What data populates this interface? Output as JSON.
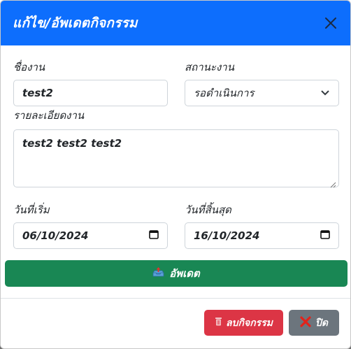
{
  "modal": {
    "title": "แก้ไข/อัพเดตกิจกรรม"
  },
  "form": {
    "name_label": "ชื่องาน",
    "name_value": "test2",
    "status_label": "สถานะงาน",
    "status_value": "รอดำเนินการ",
    "detail_label": "รายละเอียดงาน",
    "detail_value": "test2 test2 test2",
    "start_label": "วันที่เริ่ม",
    "start_value": "06/10/2024",
    "end_label": "วันที่สิ้นสุด",
    "end_value": "16/10/2024"
  },
  "actions": {
    "update_label": "อัพเดต",
    "delete_label": "ลบกิจกรรม",
    "close_label": "ปิด"
  },
  "colors": {
    "header": "#0d6efd",
    "update": "#198754",
    "delete": "#dc3545",
    "close": "#6c757d"
  }
}
